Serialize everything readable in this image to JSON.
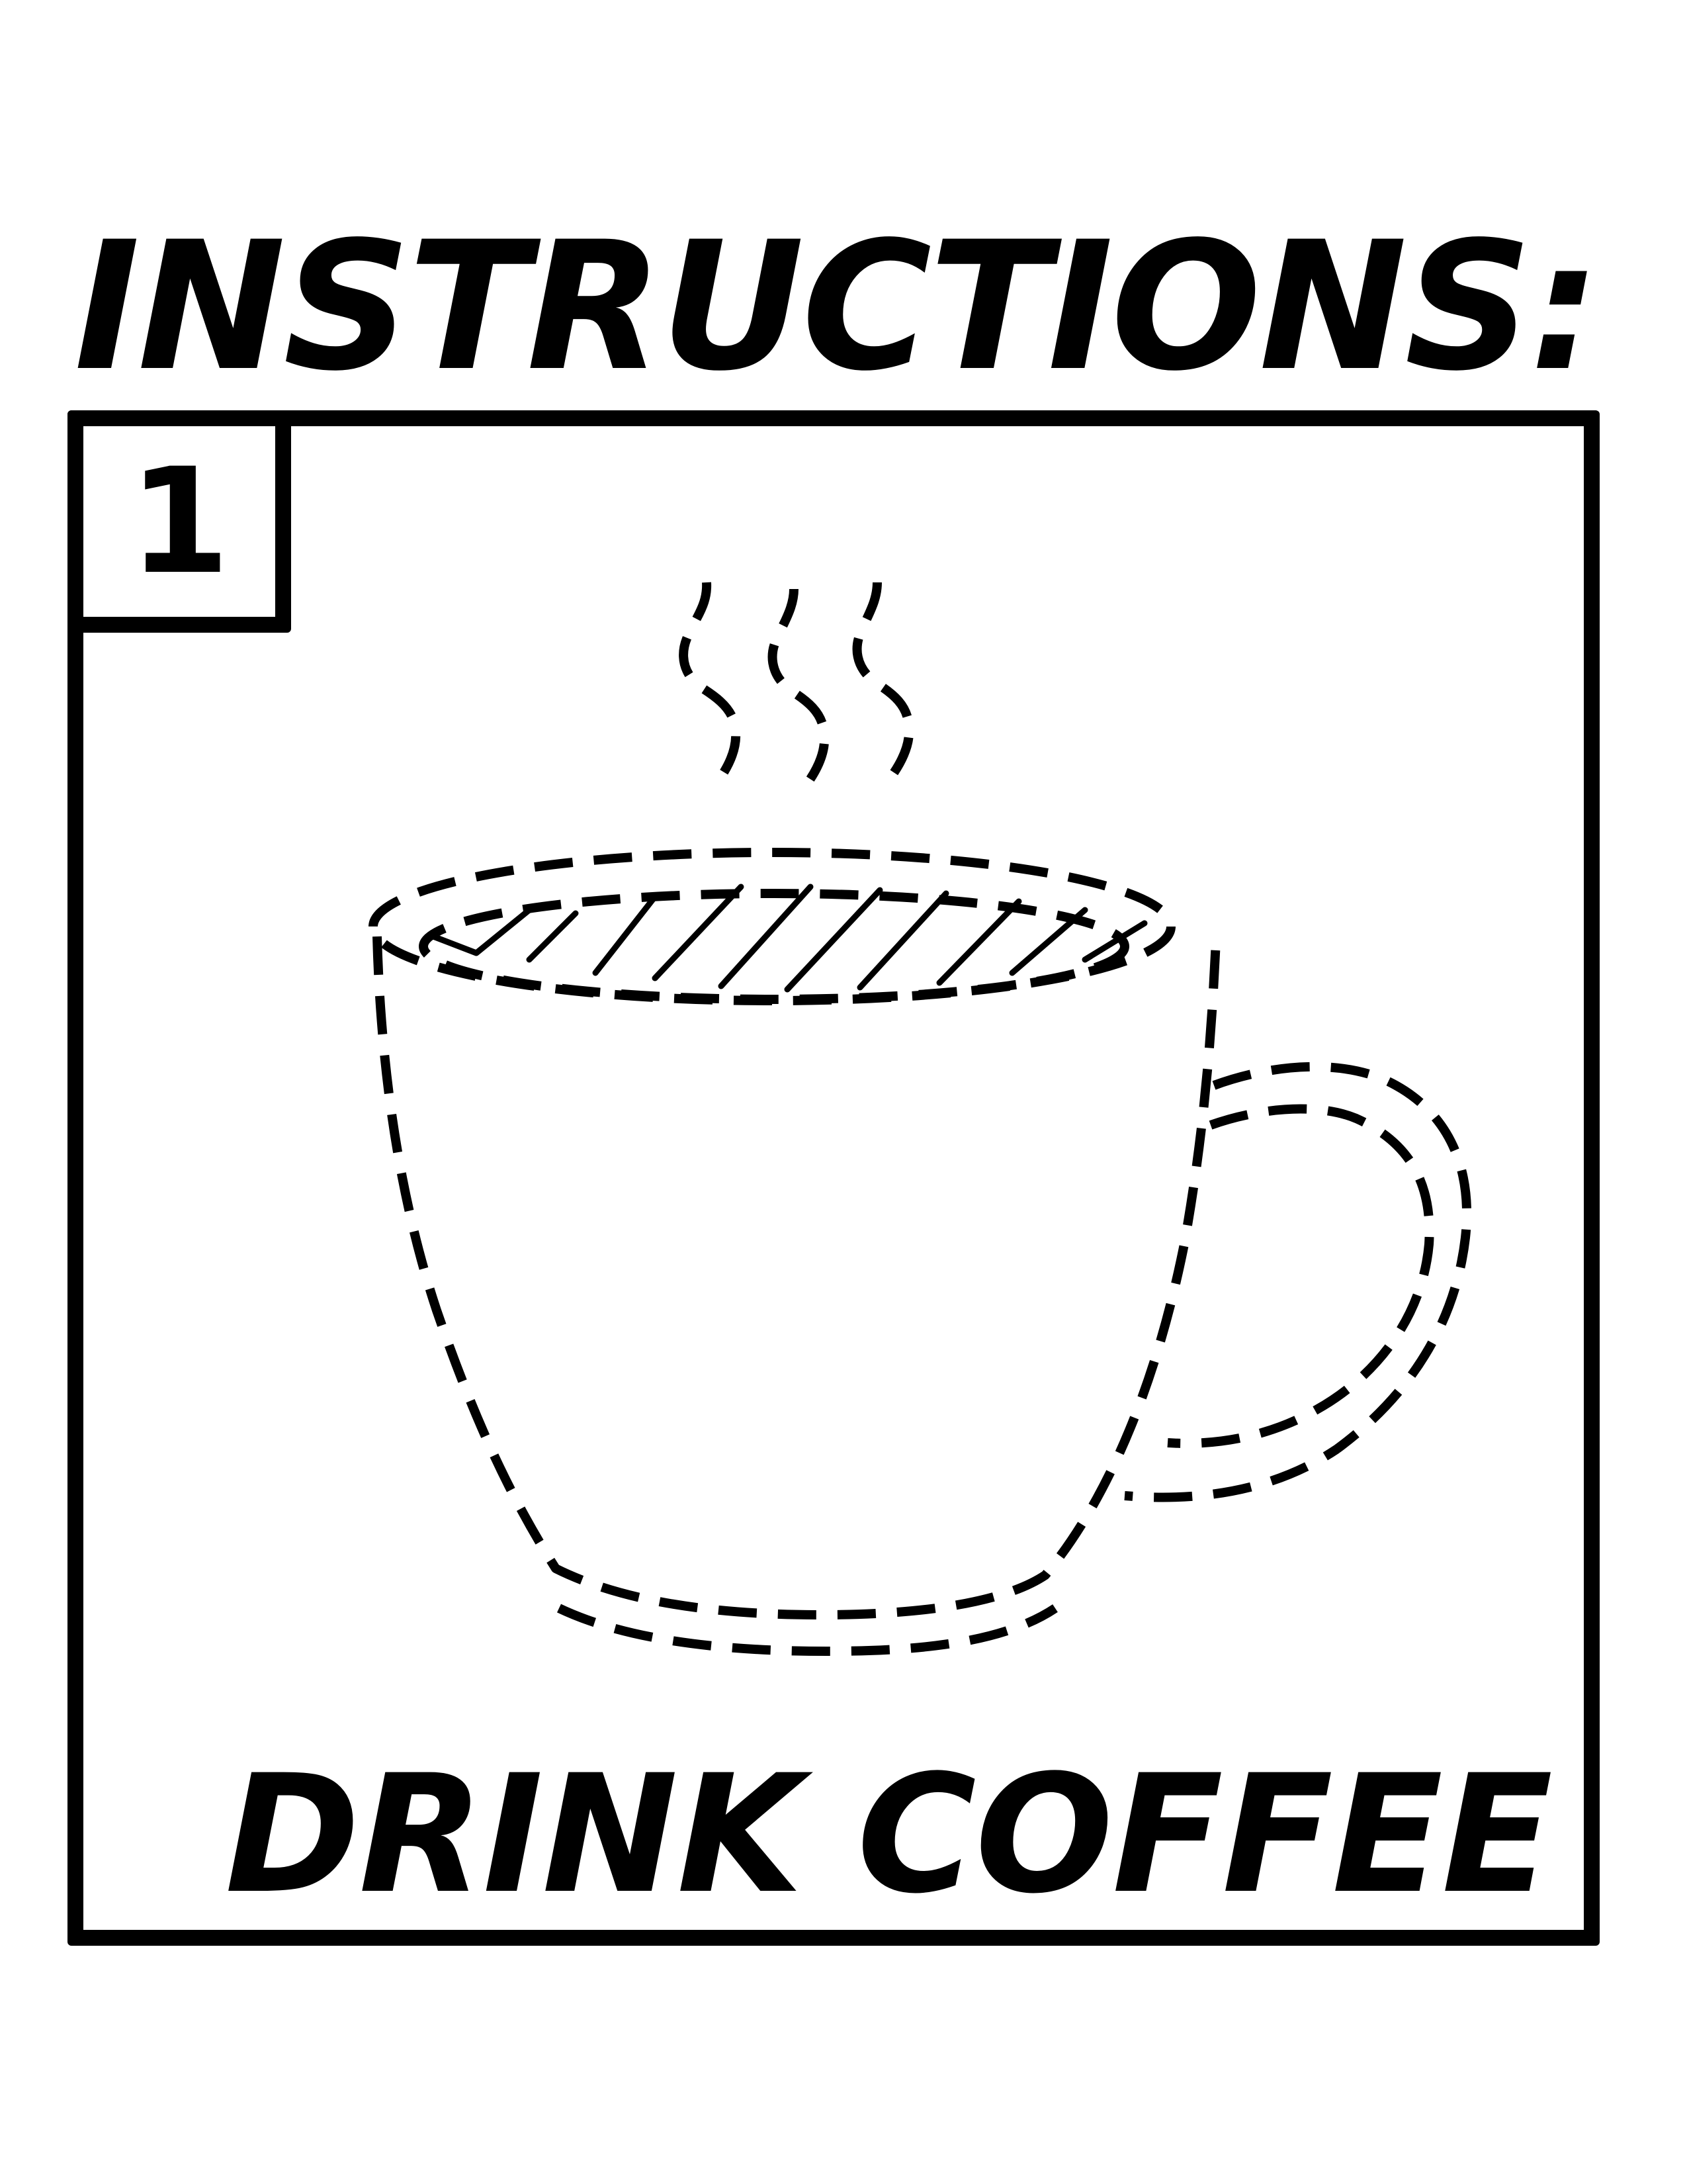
{
  "header": {
    "title": "INSTRUCTIONS:"
  },
  "step": {
    "number": "1",
    "caption": "DRINK COFFEE",
    "illustration": {
      "icon": "coffee-cup-icon",
      "steam_icon": "steam-icon",
      "line_style": "dashed",
      "stroke_color": "#000000"
    }
  }
}
